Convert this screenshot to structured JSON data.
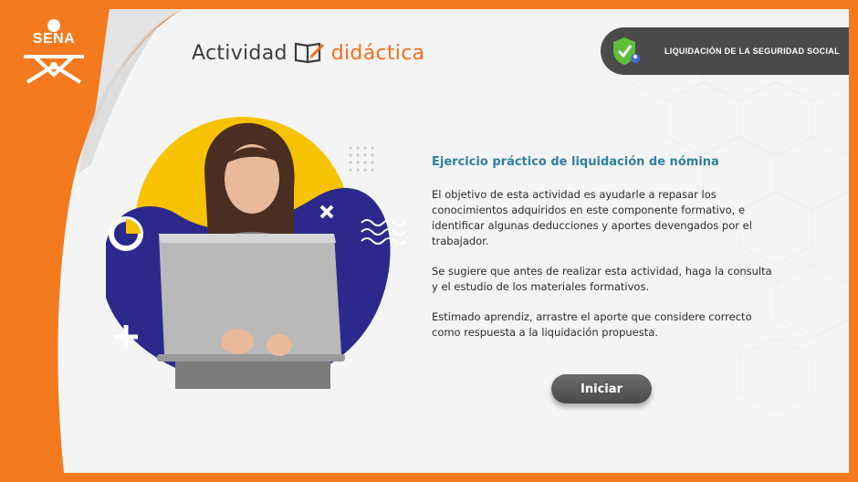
{
  "brand": {
    "logo_text": "SENA",
    "activity_word": "Actividad",
    "didactic_word": "didáctica"
  },
  "header": {
    "course_title": "LIQUIDACIÓN DE LA SEGURIDAD SOCIAL"
  },
  "main": {
    "title": "Ejercicio práctico de liquidación de nómina",
    "paragraphs": [
      "El objetivo de esta actividad es ayudarle a repasar los conocimientos adquiridos en este componente formativo, e identificar algunas deducciones y aportes devengados por el trabajador.",
      "Se sugiere que antes de realizar esta actividad, haga la consulta y el estudio de los materiales formativos.",
      "Estimado aprendiz, arrastre el aporte que considere correcto como respuesta a la liquidación propuesta."
    ],
    "start_button": "Iniciar"
  },
  "colors": {
    "frame_orange": "#f47a20",
    "title_blue": "#2e7fa0",
    "dark_pill": "#4b4b4b",
    "yellow_blob": "#f7c300",
    "navy_blob": "#2b2a8c"
  },
  "icons": {
    "logo": "sena-logo",
    "book": "book-pencil-icon",
    "shield": "shield-check-icon"
  }
}
